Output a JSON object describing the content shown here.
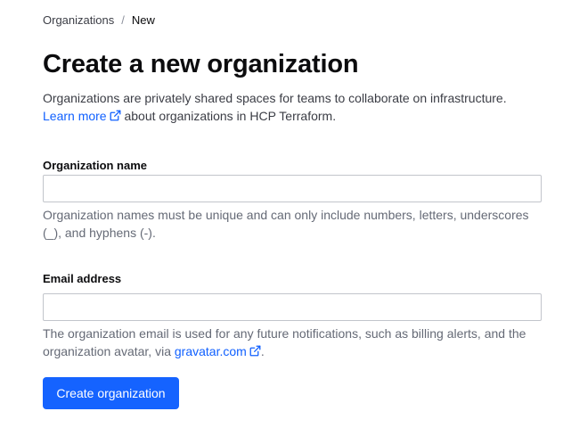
{
  "breadcrumb": {
    "items": [
      {
        "label": "Organizations"
      },
      {
        "label": "New"
      }
    ],
    "separator": "/"
  },
  "header": {
    "title": "Create a new organization",
    "description": "Organizations are privately shared spaces for teams to collaborate on infrastructure.",
    "learn_more_link": "Learn more",
    "learn_more_suffix": "about organizations in HCP Terraform."
  },
  "form": {
    "org_name": {
      "label": "Organization name",
      "value": "",
      "placeholder": "",
      "help": "Organization names must be unique and can only include numbers, letters, underscores (_), and hyphens (-)."
    },
    "email": {
      "label": "Email address",
      "value": "",
      "placeholder": "",
      "help_prefix": "The organization email is used for any future notifications, such as billing alerts, and the organization avatar, via ",
      "help_link": "gravatar.com",
      "help_suffix": "."
    },
    "submit_label": "Create organization"
  },
  "icons": {
    "external_link": "external-link-icon"
  },
  "colors": {
    "primary": "#1563ff",
    "link": "#1060ff",
    "text": "#0c0c0e",
    "muted": "#656a76",
    "border": "#c2c5cb"
  }
}
